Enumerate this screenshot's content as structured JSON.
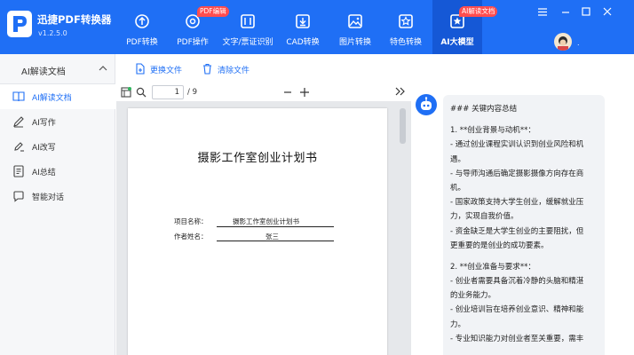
{
  "app": {
    "name": "迅捷PDF转换器",
    "version": "v1.2.5.0"
  },
  "nav": {
    "tabs": [
      {
        "label": "PDF转换",
        "icon": "refresh-icon"
      },
      {
        "label": "PDF操作",
        "icon": "settings-icon",
        "badge": "PDF编辑"
      },
      {
        "label": "文字/票证识别",
        "icon": "ocr-icon"
      },
      {
        "label": "CAD转换",
        "icon": "download-box-icon"
      },
      {
        "label": "图片转换",
        "icon": "image-icon"
      },
      {
        "label": "特色转换",
        "icon": "star-icon"
      },
      {
        "label": "AI大模型",
        "icon": "ai-icon",
        "badge": "AI解读文档",
        "active": true
      }
    ]
  },
  "user": {
    "dot": "."
  },
  "sidebar": {
    "title": "AI解读文档",
    "items": [
      {
        "label": "AI解读文档",
        "icon": "book-icon",
        "active": true
      },
      {
        "label": "AI写作",
        "icon": "pen-icon"
      },
      {
        "label": "AI改写",
        "icon": "edit-icon"
      },
      {
        "label": "AI总结",
        "icon": "document-icon"
      },
      {
        "label": "智能对话",
        "icon": "chat-icon"
      }
    ]
  },
  "toolbar": {
    "replace_label": "更换文件",
    "clear_label": "清除文件"
  },
  "viewer": {
    "page_current": "1",
    "page_total": "/ 9",
    "doc_title": "摄影工作室创业计划书",
    "field1_label": "项目名称：",
    "field1_value": "摄影工作室创业计划书",
    "field2_label": "作者姓名：",
    "field2_value": "张三"
  },
  "ai_panel": {
    "lines": [
      "### 关键内容总结",
      "",
      "1. **创业背景与动机**：",
      "- 通过创业课程实训认识到创业风险和机",
      "遇。",
      "- 与导师沟通后确定摄影摄像方向存在商",
      "机。",
      "- 国家政策支持大学生创业，缓解就业压",
      "力，实现自我价值。",
      "- 资金缺乏是大学生创业的主要阻扰，但",
      "更重要的是创业的成功要素。",
      "",
      "2. **创业准备与要求**：",
      "- 创业者需要具备沉着冷静的头脑和精湛",
      "的业务能力。",
      "- 创业培训旨在培养创业意识、精神和能",
      "力。",
      "- 专业知识能力对创业者至关重要，需丰"
    ]
  },
  "colors": {
    "brand": "#1f6ff5",
    "badge": "#ff4d4f"
  }
}
